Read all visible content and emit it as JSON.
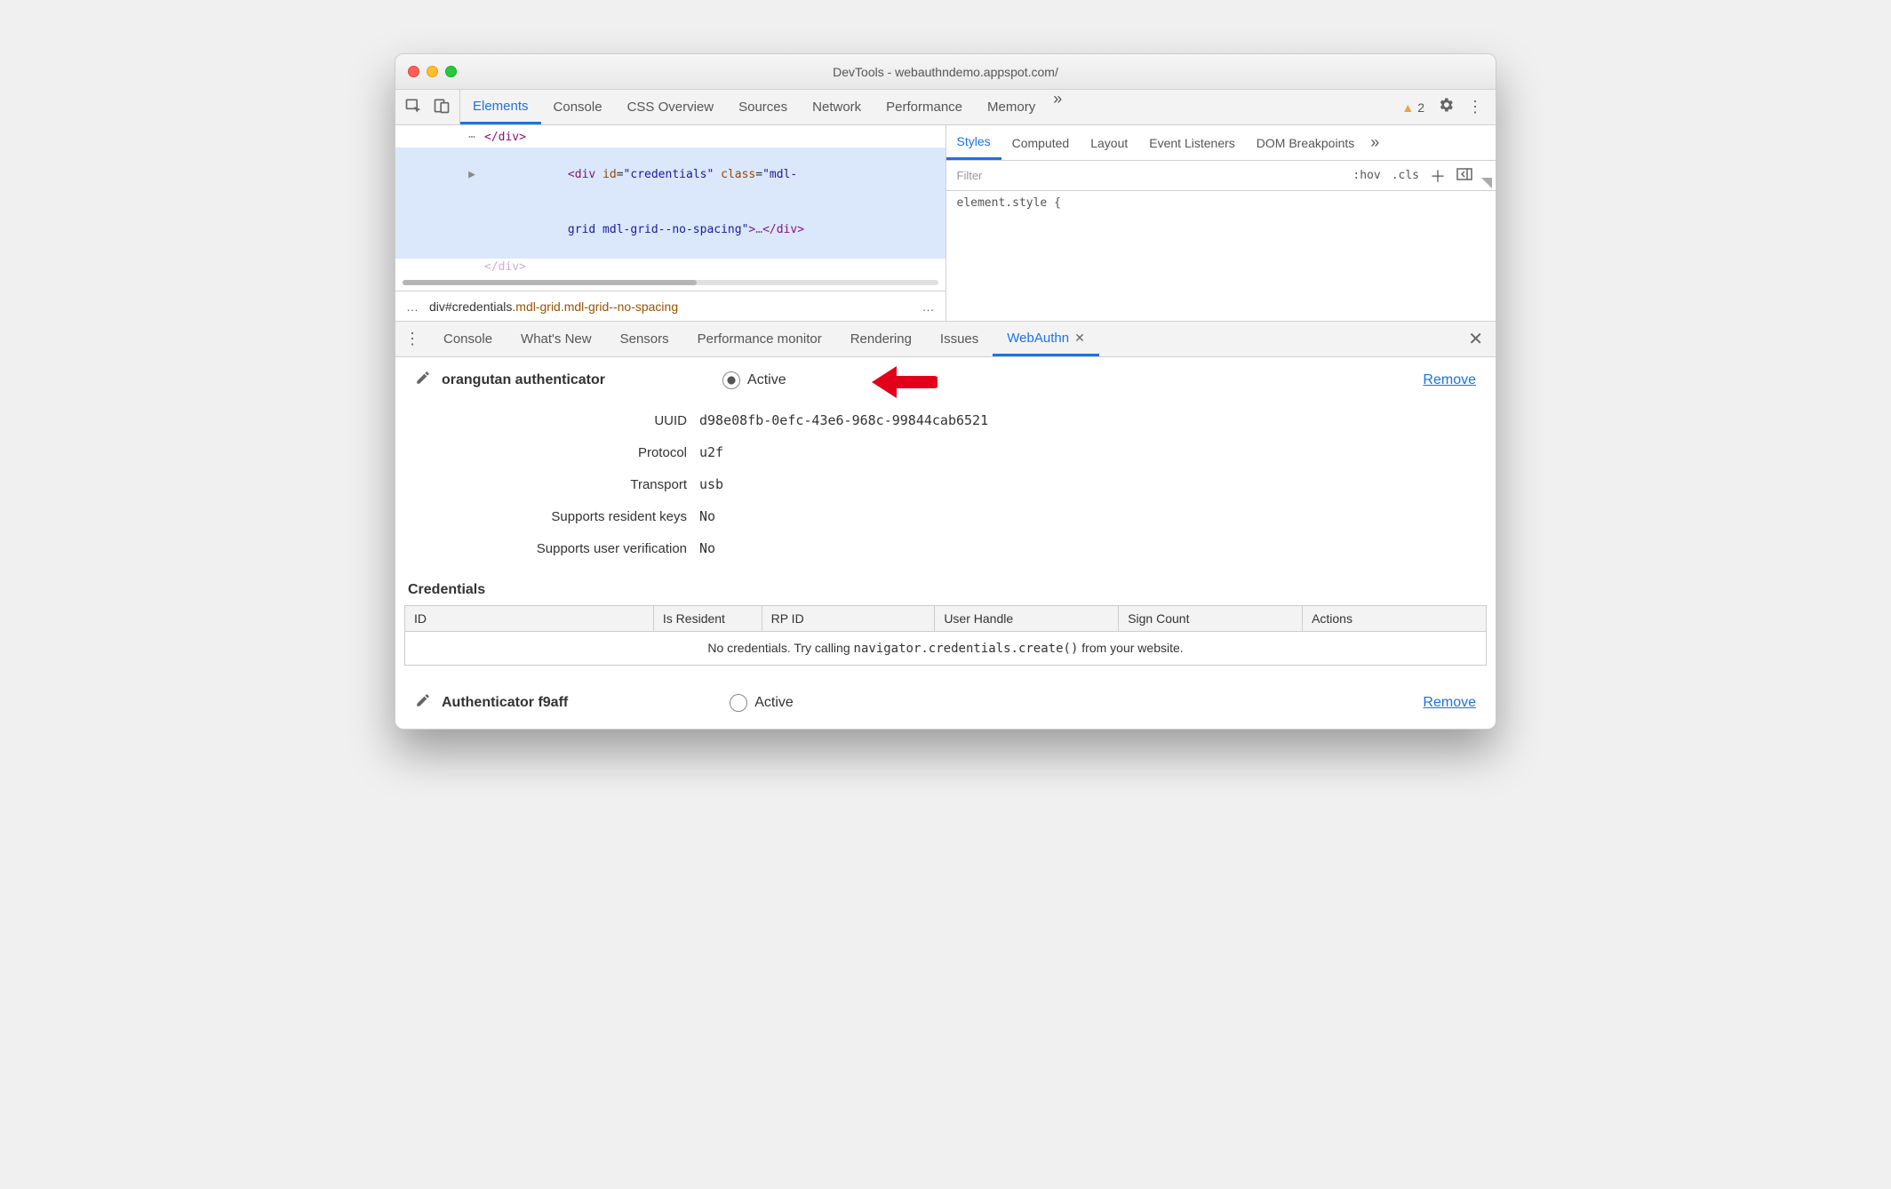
{
  "titlebar": {
    "title": "DevTools - webauthndemo.appspot.com/"
  },
  "toolbar": {
    "tabs": [
      "Elements",
      "Console",
      "CSS Overview",
      "Sources",
      "Network",
      "Performance",
      "Memory"
    ],
    "active_index": 0,
    "more": "»",
    "warn_count": "2"
  },
  "dom": {
    "line0_close": "</div>",
    "arrow": "▶",
    "open_lt": "<",
    "tag": "div",
    "sp": " ",
    "id_attr": "id",
    "eq": "=",
    "q": "\"",
    "id_val": "credentials",
    "class_attr": "class",
    "class_val_a": "mdl-",
    "class_val_b": "grid mdl-grid--no-spacing",
    "gt": ">",
    "ell": "…",
    "close_lt": "</",
    "line2_partial": "</div>",
    "breadcrumb_pre": "div#credentials",
    "breadcrumb_cls": ".mdl-grid.mdl-grid--no-spacing",
    "bc_ell": "…"
  },
  "styles": {
    "tabs": [
      "Styles",
      "Computed",
      "Layout",
      "Event Listeners",
      "DOM Breakpoints"
    ],
    "active_index": 0,
    "more": "»",
    "filter_placeholder": "Filter",
    "hov": ":hov",
    "cls": ".cls",
    "element_style": "element.style {"
  },
  "drawer": {
    "tabs": [
      "Console",
      "What's New",
      "Sensors",
      "Performance monitor",
      "Rendering",
      "Issues",
      "WebAuthn"
    ],
    "active_index": 6
  },
  "auth1": {
    "name": "orangutan authenticator",
    "active_label": "Active",
    "remove": "Remove",
    "fields": [
      {
        "label": "UUID",
        "value": "d98e08fb-0efc-43e6-968c-99844cab6521"
      },
      {
        "label": "Protocol",
        "value": "u2f"
      },
      {
        "label": "Transport",
        "value": "usb"
      },
      {
        "label": "Supports resident keys",
        "value": "No"
      },
      {
        "label": "Supports user verification",
        "value": "No"
      }
    ]
  },
  "credentials": {
    "heading": "Credentials",
    "columns": [
      "ID",
      "Is Resident",
      "RP ID",
      "User Handle",
      "Sign Count",
      "Actions"
    ],
    "empty_pre": "No credentials. Try calling ",
    "empty_code": "navigator.credentials.create()",
    "empty_post": " from your website."
  },
  "auth2": {
    "name": "Authenticator f9aff",
    "active_label": "Active",
    "remove": "Remove"
  }
}
